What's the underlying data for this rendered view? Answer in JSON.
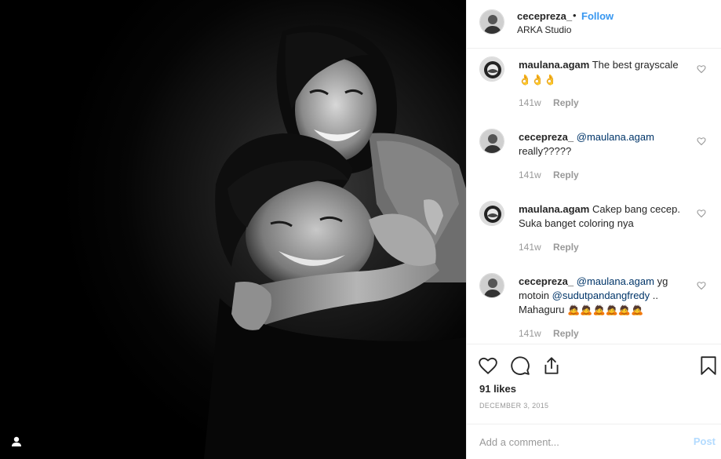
{
  "post": {
    "image_alt": "Black and white portrait of a smiling woman hugging a smiling man from behind",
    "tag_icon": "user-tag-icon"
  },
  "header": {
    "username": "cecepreza_",
    "separator": "•",
    "follow_label": "Follow",
    "location": "ARKA Studio"
  },
  "comments": [
    {
      "username": "maulana.agam",
      "parts": [
        {
          "t": "The best grayscale"
        },
        {
          "t": " 👌👌👌",
          "emoji": true
        }
      ],
      "time": "141w",
      "reply": "Reply"
    },
    {
      "username": "cecepreza_",
      "parts": [
        {
          "t": "@maulana.agam",
          "mention": true
        },
        {
          "t": " really?????"
        }
      ],
      "time": "141w",
      "reply": "Reply"
    },
    {
      "username": "maulana.agam",
      "parts": [
        {
          "t": "Cakep bang cecep. Suka banget coloring nya"
        }
      ],
      "time": "141w",
      "reply": "Reply"
    },
    {
      "username": "cecepreza_",
      "parts": [
        {
          "t": "@maulana.agam",
          "mention": true
        },
        {
          "t": " yg motoin "
        },
        {
          "t": "@sudutpandangfredy",
          "mention": true
        },
        {
          "t": " .. Mahaguru "
        },
        {
          "t": "🙇🙇🙇🙇🙇🙇",
          "emoji": true
        }
      ],
      "time": "141w",
      "reply": "Reply"
    }
  ],
  "actions": {
    "likes": "91 likes",
    "date": "DECEMBER 3, 2015"
  },
  "add_comment": {
    "placeholder": "Add a comment...",
    "post_label": "Post"
  },
  "colors": {
    "follow": "#3897f0",
    "mention": "#003569",
    "post_disabled": "#b3dbff"
  }
}
